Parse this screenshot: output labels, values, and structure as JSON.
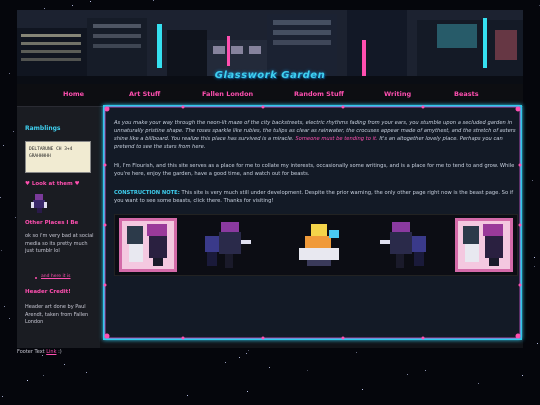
{
  "site": {
    "title": "Glasswork Garden"
  },
  "nav": [
    {
      "label": "Home"
    },
    {
      "label": "Art Stuff"
    },
    {
      "label": "Fallen London"
    },
    {
      "label": "Random Stuff"
    },
    {
      "label": "Writing"
    },
    {
      "label": "Beasts"
    }
  ],
  "sidebar": {
    "ramblings_heading": "Ramblings",
    "box_lines": [
      "DELTARUNE CH 3+4",
      "GRAHHHHH"
    ],
    "look_heading": "♥ Look at them ♥",
    "other_places_heading": "Other Places I Be",
    "other_places_text": "ok so i'm very bad at social media so its pretty much just tumblr lol",
    "other_places_link": "and here it is",
    "header_credit_heading": "Header Credit!",
    "header_credit_text": "Header art done by Paul Arendt, taken from Fallen London"
  },
  "main": {
    "intro": "As you make your way through the neon-lit maze of the city backstreets, electric rhythms fading from your ears, you stumble upon a secluded garden in unnaturally pristine shape. The roses sparkle like rubies, the tulips as clear as rainwater, the crocuses appear made of amythest, and the stretch of asters shine like a billboard. You realize this place has survived is a miracle.",
    "intro_pink": "Someone must be tending to it.",
    "intro_end": "It's an altogether lovely place. Perhaps you can pretend to see the stars from here.",
    "welcome": "Hi, I'm Flourish, and this site serves as a place for me to collate my interests, occasionally some writings, and is a place for me to tend to and grow. While you're here, enjoy the garden, have a good time, and watch out for beasts.",
    "note_label": "CONSTRUCTION NOTE:",
    "note_text": "This site is very much still under development. Despite the prior warning, the only other page right now is the beast page. So if you want to see some beasts, click there. Thanks for visiting!"
  },
  "footer": {
    "prefix": "Footer Text",
    "link": "Link",
    "suffix": ":)"
  },
  "colors": {
    "accent_pink": "#ff4fb0",
    "accent_cyan": "#2fc7ea"
  }
}
